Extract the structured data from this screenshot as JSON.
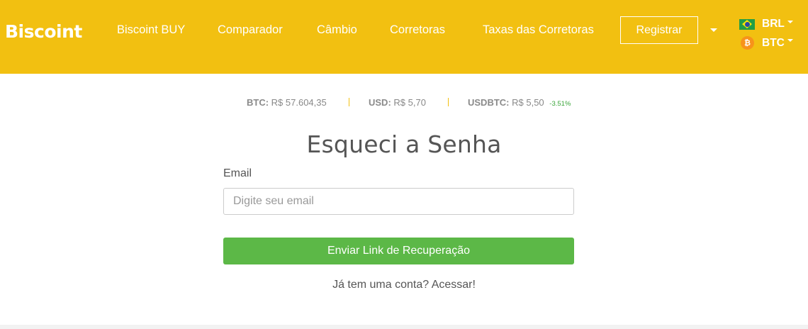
{
  "header": {
    "logo_text": "Biscoint",
    "nav": [
      {
        "label": "Biscoint BUY"
      },
      {
        "label": "Comparador"
      },
      {
        "label": "Câmbio"
      },
      {
        "label": "Corretoras"
      },
      {
        "label": "Taxas das Corretoras"
      }
    ],
    "register_label": "Registrar",
    "fiat_currency": "BRL",
    "crypto_currency": "BTC",
    "crypto_icon": "bitcoin-icon",
    "fiat_icon": "brazil-flag-icon"
  },
  "ticker": {
    "items": [
      {
        "symbol": "BTC:",
        "value": "R$ 57.604,35",
        "change": ""
      },
      {
        "symbol": "USD:",
        "value": "R$ 5,70",
        "change": ""
      },
      {
        "symbol": "USDBTC:",
        "value": "R$ 5,50",
        "change": "-3.51%"
      }
    ]
  },
  "form": {
    "title": "Esqueci a Senha",
    "email_label": "Email",
    "email_placeholder": "Digite seu email",
    "email_value": "",
    "submit_label": "Enviar Link de Recuperação",
    "login_prompt": "Já tem uma conta? Acessar!"
  },
  "colors": {
    "brand_yellow": "#f2c011",
    "button_green": "#5cb847",
    "change_green": "#3aa53a"
  }
}
